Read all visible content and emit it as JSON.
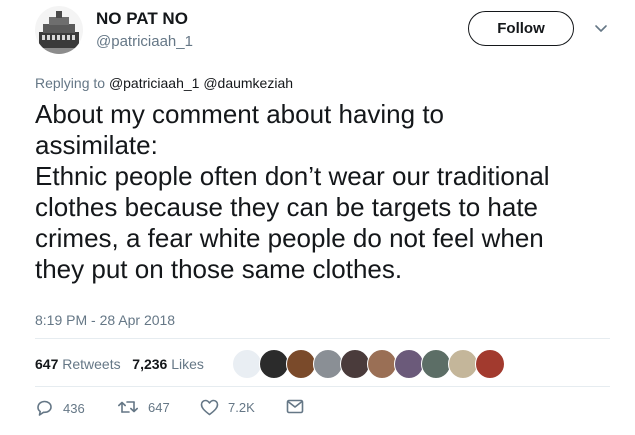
{
  "tweet": {
    "display_name": "NO PAT NO",
    "handle": "@patriciaah_1",
    "follow_label": "Follow",
    "reply_prefix": "Replying to",
    "reply_mention_1": "@patriciaah_1",
    "reply_mention_2": "@daumkeziah",
    "text_lines": [
      "About my comment about having to",
      "assimilate:",
      "Ethnic people often don’t wear our traditional",
      "clothes because they can be targets to hate",
      "crimes, a fear white people do not feel when",
      "they put on those same clothes."
    ],
    "timestamp": "8:19 PM - 28 Apr 2018"
  },
  "stats": {
    "retweets_count": "647",
    "retweets_label": "Retweets",
    "likes_count": "7,236",
    "likes_label": "Likes"
  },
  "actions": {
    "reply_count": "436",
    "retweet_count": "647",
    "like_count": "7.2K"
  },
  "icons": {
    "avatar": "profile-avatar",
    "chevron": "chevron-down-icon",
    "reply": "reply-icon",
    "retweet": "retweet-icon",
    "like": "heart-icon",
    "dm": "envelope-icon"
  },
  "colors": {
    "text": "#14171a",
    "muted": "#657786",
    "divider": "#e6ecf0"
  }
}
